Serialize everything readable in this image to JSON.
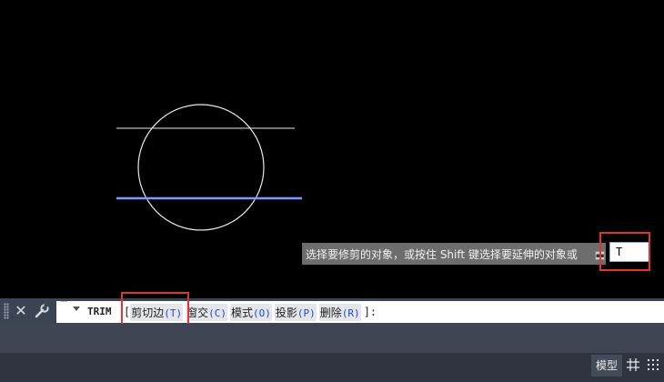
{
  "canvas": {
    "tooltip_prompt": "选择要修剪的对象，或按住 Shift 键选择要延伸的对象或",
    "dynamic_input_value": "T"
  },
  "command_line": {
    "command_name": "TRIM",
    "open_bracket": "[",
    "close_bracket": "]:",
    "options": [
      {
        "label": "剪切边",
        "key": "(T)"
      },
      {
        "label": "窗交",
        "key": "(C)"
      },
      {
        "label": "模式",
        "key": "(O)"
      },
      {
        "label": "投影",
        "key": "(P)"
      },
      {
        "label": "删除",
        "key": "(R)"
      }
    ],
    "close_icon": "close-icon",
    "settings_icon": "wrench-icon"
  },
  "status_bar": {
    "model_tab": "模型",
    "grid_icon": "grid-icon",
    "snap_icon": "snap-icon"
  },
  "colors": {
    "canvas_background": "#000000",
    "highlight": "#e03434",
    "selected_line": "#4a6cf0",
    "command_bar": "#3b4453"
  }
}
